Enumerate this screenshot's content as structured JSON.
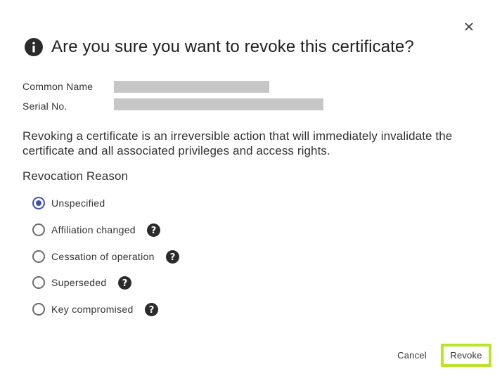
{
  "dialog": {
    "title": "Are you sure you want to revoke this certificate?",
    "fields": [
      {
        "label": "Common Name"
      },
      {
        "label": "Serial No."
      }
    ],
    "description": "Revoking a certificate is an irreversible action that will immediately invalidate the certificate and all associated privileges and access rights.",
    "reason_section_title": "Revocation Reason",
    "reasons": [
      {
        "label": "Unspecified",
        "selected": true,
        "has_help": false
      },
      {
        "label": "Affiliation changed",
        "selected": false,
        "has_help": true
      },
      {
        "label": "Cessation of operation",
        "selected": false,
        "has_help": true
      },
      {
        "label": "Superseded",
        "selected": false,
        "has_help": true
      },
      {
        "label": "Key compromised",
        "selected": false,
        "has_help": true
      }
    ],
    "buttons": {
      "cancel_label": "Cancel",
      "revoke_label": "Revoke"
    }
  },
  "colors": {
    "accent_radio": "#3f51b5",
    "focus_highlight": "#b9e32c",
    "redaction": "#c6c6c6"
  },
  "icons": {
    "close": "close-icon",
    "header": "info-icon",
    "help": "help-icon"
  }
}
